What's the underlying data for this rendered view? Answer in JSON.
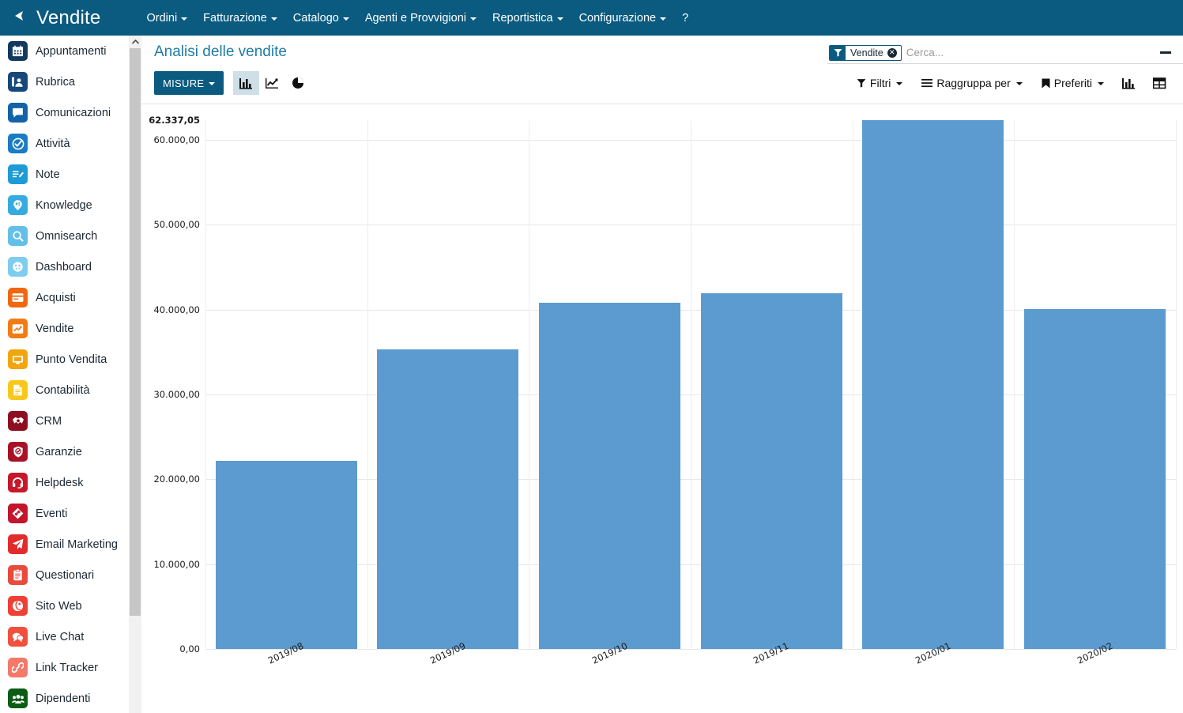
{
  "topnav": {
    "brand": "Vendite",
    "brand_icon": "pin-icon",
    "items": [
      {
        "label": "Ordini",
        "has_caret": true
      },
      {
        "label": "Fatturazione",
        "has_caret": true
      },
      {
        "label": "Catalogo",
        "has_caret": true
      },
      {
        "label": "Agenti e Provvigioni",
        "has_caret": true
      },
      {
        "label": "Reportistica",
        "has_caret": true
      },
      {
        "label": "Configurazione",
        "has_caret": true
      },
      {
        "label": "?",
        "has_caret": false
      }
    ]
  },
  "sidebar": {
    "items": [
      {
        "label": "Appuntamenti",
        "icon": "calendar-icon",
        "color": "#123a5e"
      },
      {
        "label": "Rubrica",
        "icon": "contacts-icon",
        "color": "#16497a"
      },
      {
        "label": "Comunicazioni",
        "icon": "chat-bubble-icon",
        "color": "#1263a8"
      },
      {
        "label": "Attività",
        "icon": "check-circle-icon",
        "color": "#1a7cc4"
      },
      {
        "label": "Note",
        "icon": "note-edit-icon",
        "color": "#1e9bd7"
      },
      {
        "label": "Knowledge",
        "icon": "brain-icon",
        "color": "#35abe0"
      },
      {
        "label": "Omnisearch",
        "icon": "magnifier-icon",
        "color": "#62c0e8"
      },
      {
        "label": "Dashboard",
        "icon": "gauge-icon",
        "color": "#7ccdf0"
      },
      {
        "label": "Acquisti",
        "icon": "card-icon",
        "color": "#f1670f"
      },
      {
        "label": "Vendite",
        "icon": "chart-up-icon",
        "color": "#f47b12"
      },
      {
        "label": "Punto Vendita",
        "icon": "monitor-icon",
        "color": "#f2a50c"
      },
      {
        "label": "Contabilità",
        "icon": "document-icon",
        "color": "#f7c81b"
      },
      {
        "label": "CRM",
        "icon": "handshake-icon",
        "color": "#8f0f22"
      },
      {
        "label": "Garanzie",
        "icon": "shield-check-icon",
        "color": "#a81226"
      },
      {
        "label": "Helpdesk",
        "icon": "headset-icon",
        "color": "#c6182a"
      },
      {
        "label": "Eventi",
        "icon": "ticket-icon",
        "color": "#c3152c"
      },
      {
        "label": "Email Marketing",
        "icon": "paper-plane-icon",
        "color": "#e22b2b"
      },
      {
        "label": "Questionari",
        "icon": "clipboard-icon",
        "color": "#ea4a3c"
      },
      {
        "label": "Sito Web",
        "icon": "globe-icon",
        "color": "#ef4036"
      },
      {
        "label": "Live Chat",
        "icon": "chat-double-icon",
        "color": "#f0503c"
      },
      {
        "label": "Link Tracker",
        "icon": "link-icon",
        "color": "#f4796a"
      },
      {
        "label": "Dipendenti",
        "icon": "people-icon",
        "color": "#0b5c14"
      }
    ]
  },
  "header": {
    "page_title": "Analisi delle vendite",
    "collapse_icon": "minimize-icon"
  },
  "search": {
    "facet_icon": "filter-funnel-icon",
    "facet_label": "Vendite",
    "facet_remove_icon": "close-circle-icon",
    "placeholder": "Cerca...",
    "value": ""
  },
  "toolbar": {
    "measures_label": "MISURE",
    "view_buttons": [
      {
        "name": "bar-chart-view",
        "icon": "bar-chart-icon",
        "active": true
      },
      {
        "name": "line-chart-view",
        "icon": "line-chart-icon",
        "active": false
      },
      {
        "name": "pie-chart-view",
        "icon": "pie-chart-icon",
        "active": false
      }
    ],
    "right_buttons": [
      {
        "label": "Filtri",
        "icon": "filter-funnel-icon",
        "caret": true
      },
      {
        "label": "Raggruppa per",
        "icon": "hamburger-icon",
        "caret": true
      },
      {
        "label": "Preferiti",
        "icon": "bookmark-icon",
        "caret": true
      }
    ],
    "right_icon_buttons": [
      {
        "name": "graph-view-button",
        "icon": "bar-chart-icon"
      },
      {
        "name": "pivot-view-button",
        "icon": "table-grid-icon"
      }
    ]
  },
  "chart_data": {
    "type": "bar",
    "title": "Analisi delle vendite",
    "xlabel": "",
    "ylabel": "",
    "categories": [
      "2019/08",
      "2019/09",
      "2019/10",
      "2019/11",
      "2020/01",
      "2020/02"
    ],
    "values": [
      22200.0,
      35270.0,
      40800.0,
      41950.0,
      62337.05,
      40100.0
    ],
    "ylim": [
      0,
      62337.05
    ],
    "ytick_labels": [
      "0,00",
      "10.000,00",
      "20.000,00",
      "30.000,00",
      "40.000,00",
      "50.000,00",
      "60.000,00"
    ],
    "ytick_values": [
      0,
      10000,
      20000,
      30000,
      40000,
      50000,
      60000
    ],
    "max_label": "62.337,05",
    "max_value": 62337.05,
    "bar_color": "#5b9bd0",
    "grid": true,
    "legend": false,
    "xtick_rotation": -25
  }
}
